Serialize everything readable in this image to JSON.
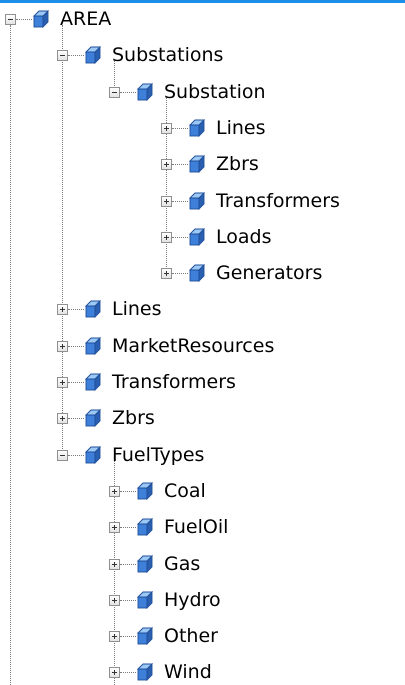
{
  "tree": {
    "root": {
      "label": "AREA",
      "children": [
        {
          "label": "Substations",
          "expanded": true,
          "children": [
            {
              "label": "Substation",
              "expanded": true,
              "children": [
                {
                  "label": "Lines",
                  "expanded": false
                },
                {
                  "label": "Zbrs",
                  "expanded": false
                },
                {
                  "label": "Transformers",
                  "expanded": false
                },
                {
                  "label": "Loads",
                  "expanded": false
                },
                {
                  "label": "Generators",
                  "expanded": false
                }
              ]
            }
          ]
        },
        {
          "label": "Lines",
          "expanded": false
        },
        {
          "label": "MarketResources",
          "expanded": false
        },
        {
          "label": "Transformers",
          "expanded": false
        },
        {
          "label": "Zbrs",
          "expanded": false
        },
        {
          "label": "FuelTypes",
          "expanded": true,
          "children": [
            {
              "label": "Coal",
              "expanded": false
            },
            {
              "label": "FuelOil",
              "expanded": false
            },
            {
              "label": "Gas",
              "expanded": false
            },
            {
              "label": "Hydro",
              "expanded": false
            },
            {
              "label": "Other",
              "expanded": false
            },
            {
              "label": "Wind",
              "expanded": false
            }
          ]
        }
      ]
    }
  },
  "colors": {
    "accent_line": "#1e8fe8",
    "cube_front": "#3d7fd9",
    "cube_top": "#9cc8f5",
    "cube_side": "#2a5fb0"
  },
  "icons": {
    "node": "cube-icon",
    "expand": "plus-icon",
    "collapse": "minus-icon"
  }
}
